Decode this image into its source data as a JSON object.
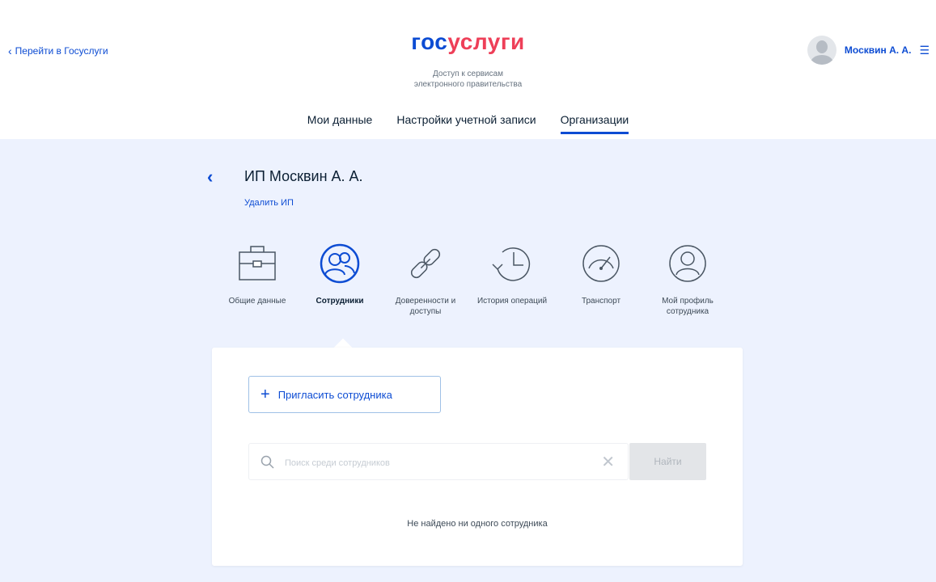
{
  "header": {
    "back_link": "Перейти в Госуслуги",
    "logo_part1": "гос",
    "logo_part2": "услуги",
    "tagline_line1": "Доступ к сервисам",
    "tagline_line2": "электронного правительства",
    "user_name": "Москвин А. А."
  },
  "tabs": [
    {
      "label": "Мои данные"
    },
    {
      "label": "Настройки учетной записи"
    },
    {
      "label": "Организации",
      "active": true
    }
  ],
  "org": {
    "title": "ИП Москвин А. А.",
    "delete_link": "Удалить ИП"
  },
  "categories": [
    {
      "label": "Общие данные",
      "icon": "briefcase-icon"
    },
    {
      "label": "Сотрудники",
      "icon": "employees-icon",
      "active": true
    },
    {
      "label": "Доверенности и доступы",
      "icon": "chain-link-icon"
    },
    {
      "label": "История операций",
      "icon": "history-icon"
    },
    {
      "label": "Транспорт",
      "icon": "speedometer-icon"
    },
    {
      "label": "Мой профиль сотрудника",
      "icon": "profile-icon"
    }
  ],
  "employees": {
    "invite_label": "Пригласить сотрудника",
    "search_placeholder": "Поиск среди сотрудников",
    "search_value": "",
    "find_label": "Найти",
    "empty_message": "Не найдено ни одного сотрудника"
  },
  "colors": {
    "accent": "#0d4cd3",
    "logo_red": "#ee3f58",
    "background": "#edf2fe"
  }
}
